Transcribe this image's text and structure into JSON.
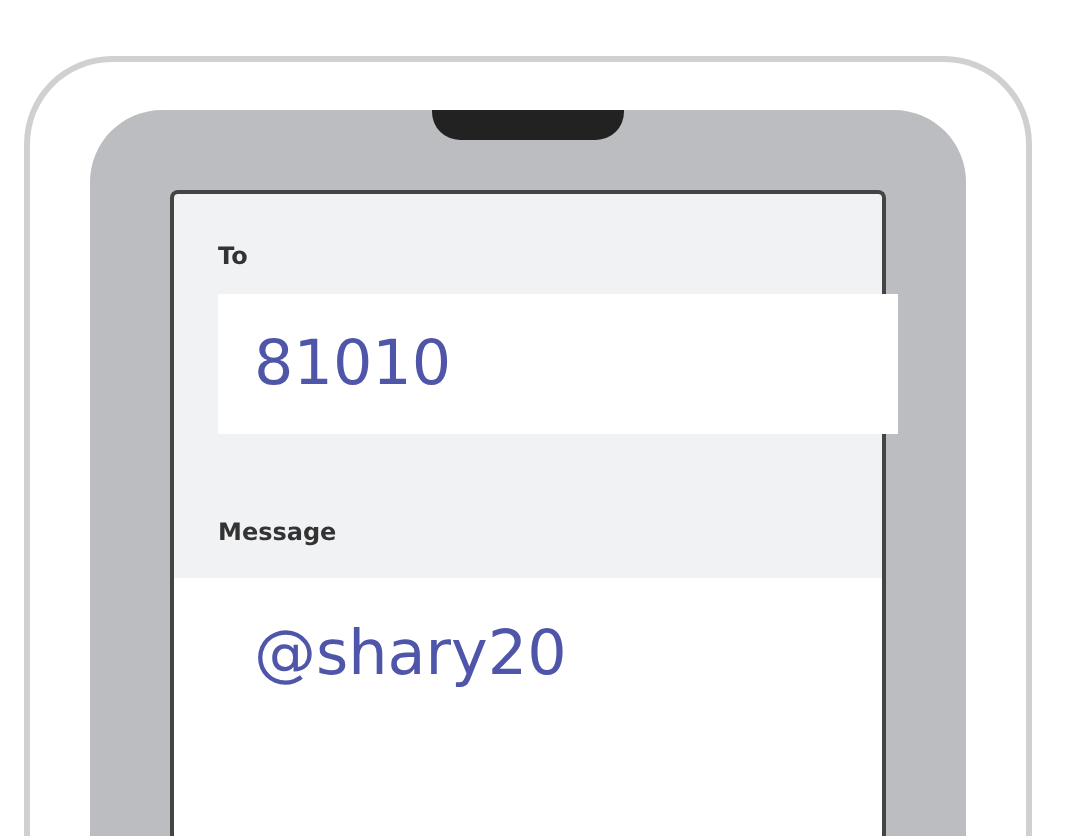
{
  "compose_screen": {
    "fields": [
      {
        "kind": "recipient",
        "label": "To",
        "value": "81010"
      },
      {
        "kind": "message",
        "label": "Message",
        "value": "@shary20"
      }
    ]
  }
}
